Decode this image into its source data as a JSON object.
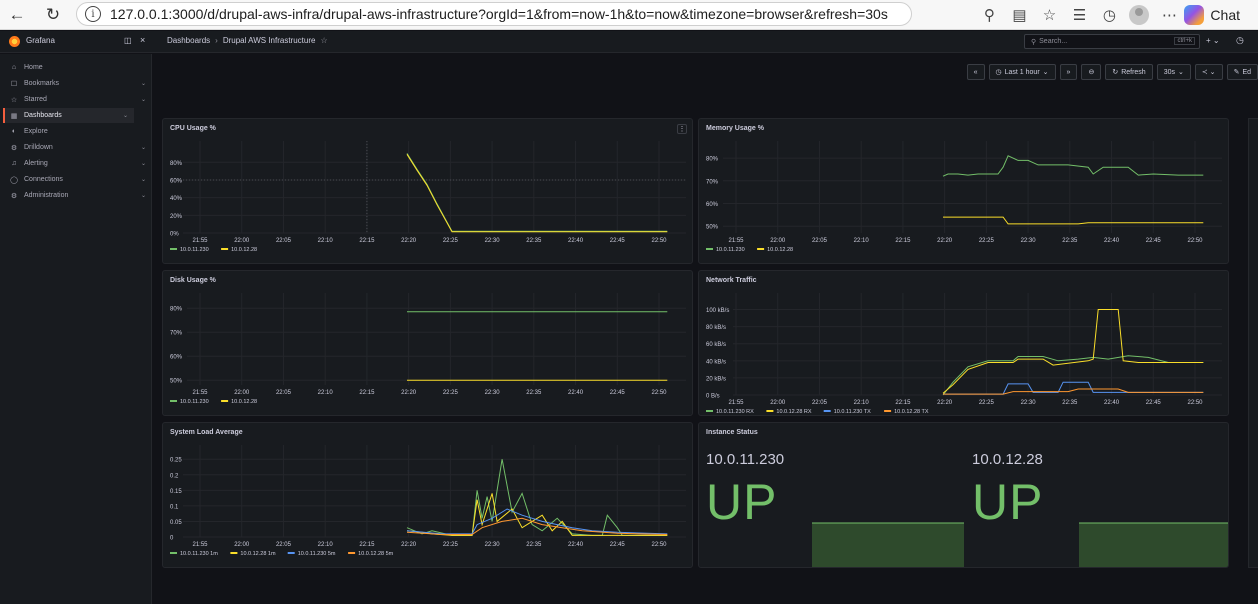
{
  "browser": {
    "url": "127.0.0.1:3000/d/drupal-aws-infra/drupal-aws-infrastructure?orgId=1&from=now-1h&to=now&timezone=browser&refresh=30s",
    "chat_label": "Chat"
  },
  "grafana": {
    "brand": "Grafana",
    "breadcrumb": [
      "Dashboards",
      "Drupal AWS Infrastructure"
    ],
    "search_placeholder": "Search...",
    "search_shortcut": "ctrl+k",
    "nav": [
      {
        "label": "Home",
        "icon": "home-icon",
        "chevron": false
      },
      {
        "label": "Bookmarks",
        "icon": "bookmark-icon",
        "chevron": true
      },
      {
        "label": "Starred",
        "icon": "star-icon",
        "chevron": true
      },
      {
        "label": "Dashboards",
        "icon": "dashboards-icon",
        "chevron": true,
        "active": true
      },
      {
        "label": "Explore",
        "icon": "explore-icon",
        "chevron": false
      },
      {
        "label": "Drilldown",
        "icon": "drilldown-icon",
        "chevron": true
      },
      {
        "label": "Alerting",
        "icon": "bell-icon",
        "chevron": true
      },
      {
        "label": "Connections",
        "icon": "connections-icon",
        "chevron": true
      },
      {
        "label": "Administration",
        "icon": "gear-icon",
        "chevron": true
      }
    ],
    "controls": {
      "time_range": "Last 1 hour",
      "refresh": "Refresh",
      "interval": "30s",
      "edit": "Ed"
    }
  },
  "colors": {
    "green": "#73bf69",
    "yellow": "#fade2a",
    "blue": "#5794f2",
    "orange": "#ff9830"
  },
  "panels": {
    "cpu": {
      "title": "CPU Usage %",
      "chart_data": {
        "type": "line",
        "x_ticks": [
          "21:55",
          "22:00",
          "22:05",
          "22:10",
          "22:15",
          "22:20",
          "22:25",
          "22:30",
          "22:35",
          "22:40",
          "22:45",
          "22:50"
        ],
        "y_ticks": [
          "80%",
          "60%",
          "40%",
          "20%",
          "0%"
        ],
        "ylim": [
          0,
          95
        ],
        "series": [
          {
            "name": "10.0.11.230",
            "color": "#73bf69",
            "points": [
              [
                22.33,
                90
              ],
              [
                22.35,
                72
              ],
              [
                22.37,
                55
              ],
              [
                22.39,
                33
              ],
              [
                22.42,
                2
              ],
              [
                22.5,
                2
              ],
              [
                22.6,
                2
              ],
              [
                22.75,
                2
              ],
              [
                22.85,
                2
              ]
            ]
          },
          {
            "name": "10.0.12.28",
            "color": "#fade2a",
            "points": [
              [
                22.33,
                89
              ],
              [
                22.35,
                71
              ],
              [
                22.37,
                54
              ],
              [
                22.39,
                32
              ],
              [
                22.42,
                1.5
              ],
              [
                22.5,
                1.5
              ],
              [
                22.6,
                1.5
              ],
              [
                22.75,
                1.5
              ],
              [
                22.85,
                1.5
              ]
            ]
          }
        ]
      }
    },
    "memory": {
      "title": "Memory Usage %",
      "chart_data": {
        "type": "line",
        "x_ticks": [
          "21:55",
          "22:00",
          "22:05",
          "22:10",
          "22:15",
          "22:20",
          "22:25",
          "22:30",
          "22:35",
          "22:40",
          "22:45",
          "22:50"
        ],
        "y_ticks": [
          "80%",
          "70%",
          "60%",
          "50%"
        ],
        "ylim": [
          47,
          84
        ],
        "series": [
          {
            "name": "10.0.11.230",
            "color": "#73bf69",
            "points": [
              [
                22.33,
                72
              ],
              [
                22.34,
                73
              ],
              [
                22.36,
                73
              ],
              [
                22.38,
                72.5
              ],
              [
                22.4,
                73
              ],
              [
                22.44,
                73
              ],
              [
                22.45,
                76
              ],
              [
                22.46,
                81
              ],
              [
                22.48,
                79
              ],
              [
                22.5,
                79
              ],
              [
                22.52,
                77
              ],
              [
                22.58,
                77
              ],
              [
                22.62,
                76
              ],
              [
                22.63,
                73
              ],
              [
                22.65,
                76
              ],
              [
                22.7,
                76
              ],
              [
                22.72,
                72.5
              ],
              [
                22.75,
                73
              ],
              [
                22.8,
                72.5
              ],
              [
                22.85,
                72.5
              ]
            ]
          },
          {
            "name": "10.0.12.28",
            "color": "#fade2a",
            "points": [
              [
                22.33,
                54
              ],
              [
                22.45,
                54
              ],
              [
                22.46,
                51
              ],
              [
                22.48,
                51
              ],
              [
                22.6,
                51
              ],
              [
                22.62,
                51.5
              ],
              [
                22.85,
                51.5
              ]
            ]
          }
        ]
      }
    },
    "disk": {
      "title": "Disk Usage %",
      "chart_data": {
        "type": "line",
        "x_ticks": [
          "21:55",
          "22:00",
          "22:05",
          "22:10",
          "22:15",
          "22:20",
          "22:25",
          "22:30",
          "22:35",
          "22:40",
          "22:45",
          "22:50"
        ],
        "y_ticks": [
          "80%",
          "70%",
          "60%",
          "50%"
        ],
        "ylim": [
          48,
          83
        ],
        "series": [
          {
            "name": "10.0.11.230",
            "color": "#73bf69",
            "points": [
              [
                22.33,
                78.5
              ],
              [
                22.85,
                78.5
              ]
            ]
          },
          {
            "name": "10.0.12.28",
            "color": "#fade2a",
            "points": [
              [
                22.33,
                50
              ],
              [
                22.85,
                50
              ]
            ]
          }
        ]
      }
    },
    "network": {
      "title": "Network Traffic",
      "chart_data": {
        "type": "line",
        "x_ticks": [
          "21:55",
          "22:00",
          "22:05",
          "22:10",
          "22:15",
          "22:20",
          "22:25",
          "22:30",
          "22:35",
          "22:40",
          "22:45",
          "22:50"
        ],
        "y_ticks": [
          "100 kB/s",
          "80 kB/s",
          "60 kB/s",
          "40 kB/s",
          "20 kB/s",
          "0 B/s"
        ],
        "ylim": [
          0,
          110
        ],
        "series": [
          {
            "name": "10.0.11.230 RX",
            "color": "#73bf69",
            "points": [
              [
                22.33,
                0
              ],
              [
                22.35,
                15
              ],
              [
                22.38,
                33
              ],
              [
                22.42,
                40
              ],
              [
                22.47,
                40
              ],
              [
                22.48,
                45
              ],
              [
                22.53,
                45
              ],
              [
                22.56,
                40
              ],
              [
                22.6,
                42
              ],
              [
                22.63,
                44
              ],
              [
                22.66,
                42
              ],
              [
                22.7,
                46
              ],
              [
                22.74,
                44
              ],
              [
                22.78,
                38
              ],
              [
                22.85,
                38
              ]
            ]
          },
          {
            "name": "10.0.12.28 RX",
            "color": "#fade2a",
            "points": [
              [
                22.33,
                2
              ],
              [
                22.35,
                12
              ],
              [
                22.38,
                30
              ],
              [
                22.42,
                38
              ],
              [
                22.47,
                38
              ],
              [
                22.48,
                42
              ],
              [
                22.53,
                42
              ],
              [
                22.55,
                35
              ],
              [
                22.62,
                40
              ],
              [
                22.63,
                42
              ],
              [
                22.64,
                100
              ],
              [
                22.68,
                100
              ],
              [
                22.69,
                40
              ],
              [
                22.72,
                38
              ],
              [
                22.85,
                38
              ]
            ]
          },
          {
            "name": "10.0.11.230 TX",
            "color": "#5794f2",
            "points": [
              [
                22.33,
                1
              ],
              [
                22.45,
                1
              ],
              [
                22.46,
                13
              ],
              [
                22.5,
                13
              ],
              [
                22.51,
                3
              ],
              [
                22.56,
                3
              ],
              [
                22.57,
                15
              ],
              [
                22.62,
                15
              ],
              [
                22.63,
                3
              ],
              [
                22.85,
                3
              ]
            ]
          },
          {
            "name": "10.0.12.28 TX",
            "color": "#ff9830",
            "points": [
              [
                22.33,
                1
              ],
              [
                22.45,
                1
              ],
              [
                22.47,
                4
              ],
              [
                22.58,
                4
              ],
              [
                22.6,
                7
              ],
              [
                22.68,
                7
              ],
              [
                22.7,
                3
              ],
              [
                22.85,
                3
              ]
            ]
          }
        ]
      }
    },
    "load": {
      "title": "System Load Average",
      "chart_data": {
        "type": "line",
        "x_ticks": [
          "21:55",
          "22:00",
          "22:05",
          "22:10",
          "22:15",
          "22:20",
          "22:25",
          "22:30",
          "22:35",
          "22:40",
          "22:45",
          "22:50"
        ],
        "y_ticks": [
          "0.25",
          "0.2",
          "0.15",
          "0.1",
          "0.05",
          "0"
        ],
        "ylim": [
          0,
          0.27
        ],
        "series": [
          {
            "name": "10.0.11.230 1m",
            "color": "#73bf69",
            "points": [
              [
                22.33,
                0.03
              ],
              [
                22.36,
                0.01
              ],
              [
                22.38,
                0.02
              ],
              [
                22.42,
                0.005
              ],
              [
                22.46,
                0.005
              ],
              [
                22.47,
                0.15
              ],
              [
                22.48,
                0.06
              ],
              [
                22.49,
                0.13
              ],
              [
                22.5,
                0.05
              ],
              [
                22.52,
                0.25
              ],
              [
                22.54,
                0.08
              ],
              [
                22.56,
                0.14
              ],
              [
                22.58,
                0.04
              ],
              [
                22.6,
                0.02
              ],
              [
                22.63,
                0.06
              ],
              [
                22.66,
                0.01
              ],
              [
                22.7,
                0.005
              ],
              [
                22.72,
                0.005
              ],
              [
                22.73,
                0.07
              ],
              [
                22.75,
                0.03
              ],
              [
                22.76,
                0.005
              ],
              [
                22.85,
                0.005
              ]
            ]
          },
          {
            "name": "10.0.12.28 1m",
            "color": "#fade2a",
            "points": [
              [
                22.33,
                0.02
              ],
              [
                22.36,
                0.015
              ],
              [
                22.38,
                0.01
              ],
              [
                22.42,
                0.005
              ],
              [
                22.46,
                0.005
              ],
              [
                22.47,
                0.12
              ],
              [
                22.48,
                0.04
              ],
              [
                22.5,
                0.14
              ],
              [
                22.51,
                0.05
              ],
              [
                22.54,
                0.09
              ],
              [
                22.56,
                0.03
              ],
              [
                22.6,
                0.07
              ],
              [
                22.62,
                0.02
              ],
              [
                22.64,
                0.05
              ],
              [
                22.66,
                0.005
              ],
              [
                22.85,
                0.005
              ]
            ]
          },
          {
            "name": "10.0.11.230 5m",
            "color": "#5794f2",
            "points": [
              [
                22.33,
                0.02
              ],
              [
                22.4,
                0.01
              ],
              [
                22.46,
                0.01
              ],
              [
                22.47,
                0.04
              ],
              [
                22.5,
                0.06
              ],
              [
                22.53,
                0.09
              ],
              [
                22.56,
                0.07
              ],
              [
                22.6,
                0.05
              ],
              [
                22.63,
                0.04
              ],
              [
                22.66,
                0.03
              ],
              [
                22.7,
                0.02
              ],
              [
                22.75,
                0.015
              ],
              [
                22.85,
                0.01
              ]
            ]
          },
          {
            "name": "10.0.12.28 5m",
            "color": "#ff9830",
            "points": [
              [
                22.33,
                0.015
              ],
              [
                22.4,
                0.008
              ],
              [
                22.46,
                0.008
              ],
              [
                22.48,
                0.03
              ],
              [
                22.52,
                0.05
              ],
              [
                22.56,
                0.06
              ],
              [
                22.6,
                0.04
              ],
              [
                22.64,
                0.03
              ],
              [
                22.68,
                0.02
              ],
              [
                22.75,
                0.012
              ],
              [
                22.85,
                0.008
              ]
            ]
          }
        ]
      }
    },
    "status": {
      "title": "Instance Status",
      "instances": [
        {
          "name": "10.0.11.230",
          "value": "UP"
        },
        {
          "name": "10.0.12.28",
          "value": "UP"
        }
      ]
    }
  }
}
